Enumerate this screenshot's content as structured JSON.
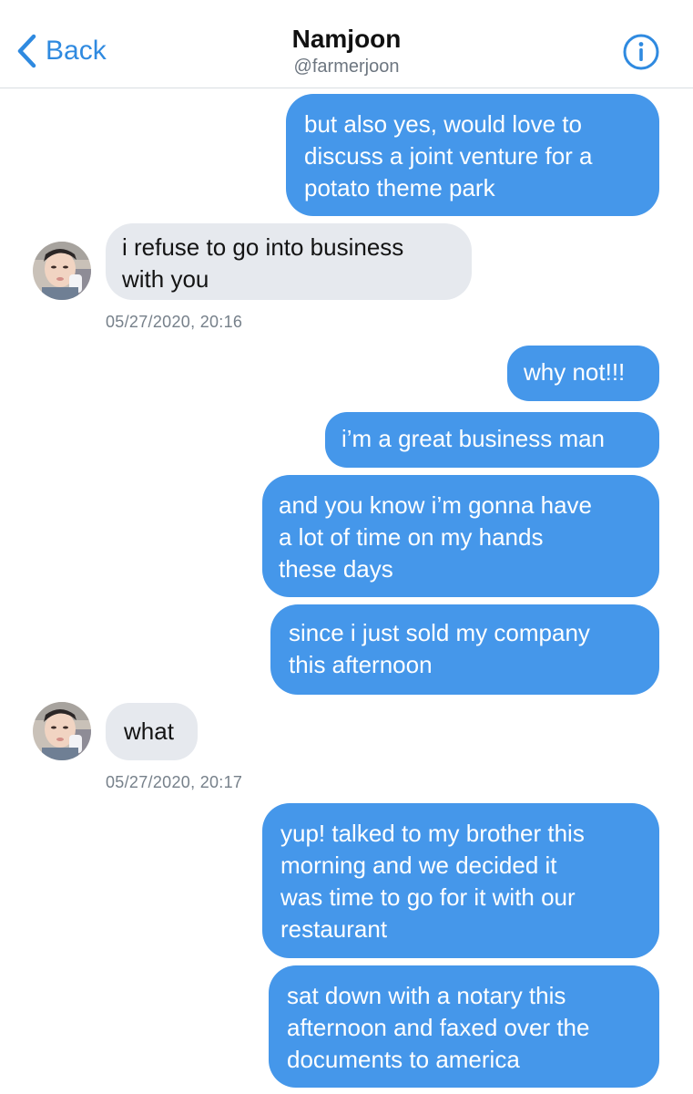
{
  "header": {
    "back_label": "Back",
    "name": "Namjoon",
    "handle": "@farmerjoon"
  },
  "colors": {
    "accent": "#2f8ae0",
    "outgoing_bubble": "#4597ea",
    "incoming_bubble": "#e6e9ee",
    "timestamp_text": "#76808a"
  },
  "messages": [
    {
      "direction": "out",
      "text": "but also yes, would love to\ndiscuss a joint venture for a\npotato theme park"
    },
    {
      "direction": "in",
      "text": "i refuse to go into business\nwith you"
    },
    {
      "direction": "out",
      "text": "why not!!!"
    },
    {
      "direction": "out",
      "text": "i’m a great business man"
    },
    {
      "direction": "out",
      "text": "and you know i’m gonna have\na lot of time on my hands\nthese days"
    },
    {
      "direction": "out",
      "text": "since i just sold my company\nthis afternoon"
    },
    {
      "direction": "in",
      "text": "what"
    },
    {
      "direction": "out",
      "text": "yup! talked to my brother this\nmorning and we decided it\nwas time to go for it with our\nrestaurant"
    },
    {
      "direction": "out",
      "text": "sat down with a notary this\nafternoon and faxed over the\ndocuments to america"
    }
  ],
  "timestamps": [
    "05/27/2020, 20:16",
    "05/27/2020, 20:17"
  ]
}
